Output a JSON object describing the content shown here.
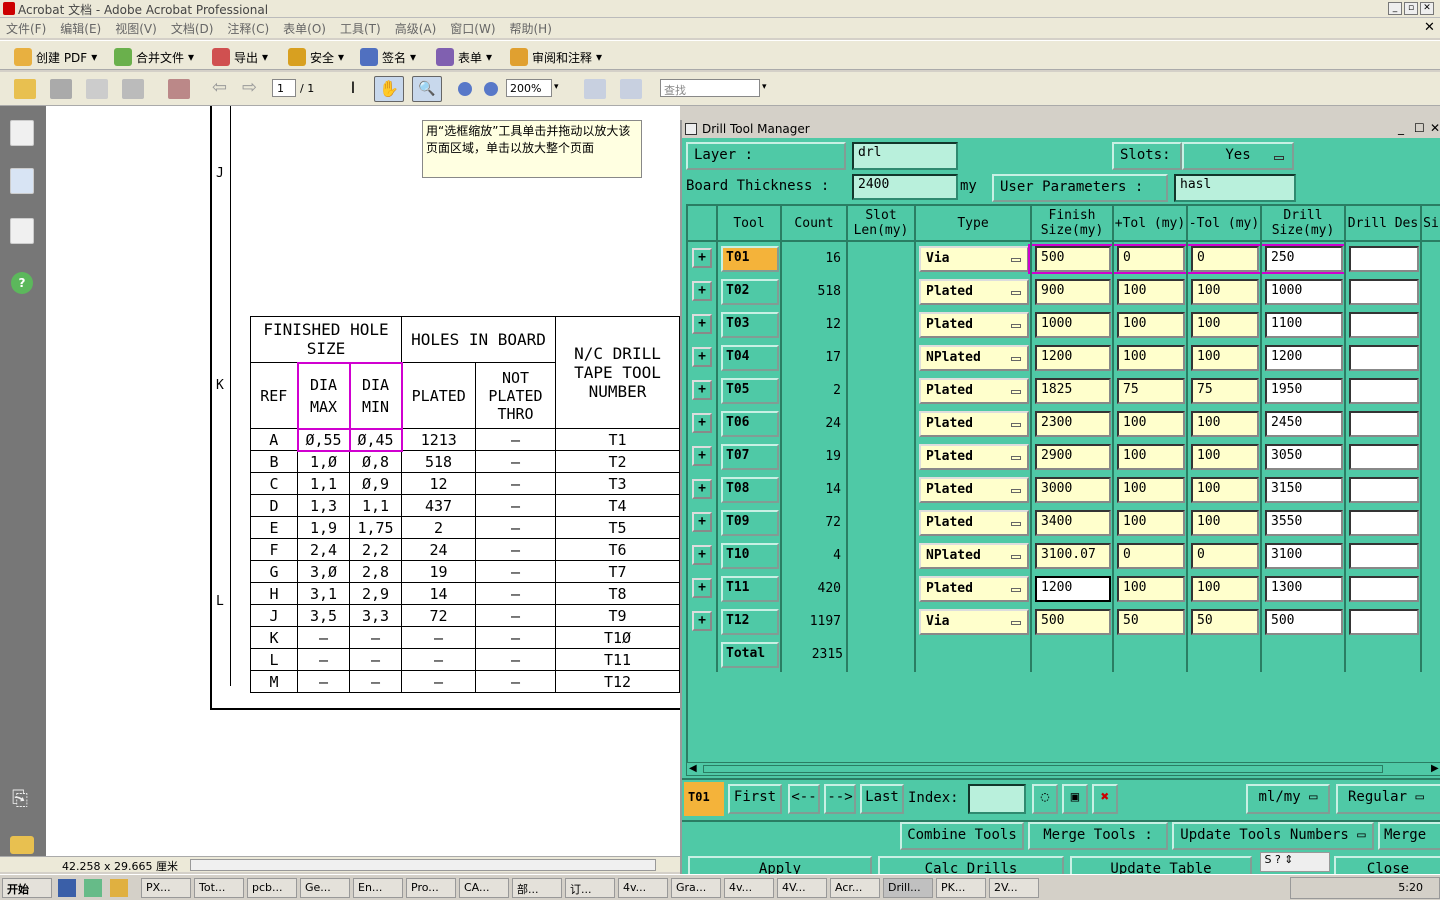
{
  "window": {
    "title": "Acrobat 文档 - Adobe Acrobat Professional"
  },
  "menu": [
    "文件(F)",
    "编辑(E)",
    "视图(V)",
    "文档(D)",
    "注释(C)",
    "表单(O)",
    "工具(T)",
    "高级(A)",
    "窗口(W)",
    "帮助(H)"
  ],
  "toolbar1": [
    "创建 PDF",
    "合并文件",
    "导出",
    "安全",
    "签名",
    "表单",
    "审阅和注释"
  ],
  "toolbar2": {
    "page_current": "1",
    "page_total": "/ 1",
    "zoom": "200%",
    "search_placeholder": "查找"
  },
  "tooltip": "用“选框缩放”工具单击并拖动以放大该页面区域，单击以放大整个页面",
  "status": {
    "page_size": "42.258 x 29.665 厘米"
  },
  "drawing": {
    "row_letters": {
      "j": "J",
      "k": "K",
      "l": "L"
    },
    "table_headers": {
      "finished": "FINISHED HOLE SIZE",
      "holes": "HOLES IN BOARD",
      "nc": "N/C DRILL TAPE TOOL NUMBER",
      "ref": "REF",
      "dia_max": "DIA MAX",
      "dia_min": "DIA MIN",
      "plated": "PLATED",
      "not_plated": "NOT PLATED THRO"
    },
    "rows": [
      [
        "A",
        "Ø,55",
        "Ø,45",
        "1213",
        "–",
        "T1"
      ],
      [
        "B",
        "1,Ø",
        "Ø,8",
        "518",
        "–",
        "T2"
      ],
      [
        "C",
        "1,1",
        "Ø,9",
        "12",
        "–",
        "T3"
      ],
      [
        "D",
        "1,3",
        "1,1",
        "437",
        "–",
        "T4"
      ],
      [
        "E",
        "1,9",
        "1,75",
        "2",
        "–",
        "T5"
      ],
      [
        "F",
        "2,4",
        "2,2",
        "24",
        "–",
        "T6"
      ],
      [
        "G",
        "3,Ø",
        "2,8",
        "19",
        "–",
        "T7"
      ],
      [
        "H",
        "3,1",
        "2,9",
        "14",
        "–",
        "T8"
      ],
      [
        "J",
        "3,5",
        "3,3",
        "72",
        "–",
        "T9"
      ],
      [
        "K",
        "–",
        "–",
        "–",
        "–",
        "T1Ø"
      ],
      [
        "L",
        "–",
        "–",
        "–",
        "–",
        "T11"
      ],
      [
        "M",
        "–",
        "–",
        "–",
        "–",
        "T12"
      ]
    ]
  },
  "dtm": {
    "title": "Drill Tool Manager",
    "layer_label": "Layer           :",
    "layer_value": "drl",
    "slots_label": "Slots:",
    "slots_value": "Yes",
    "board_thickness_label": "Board Thickness :",
    "board_thickness_value": "2400",
    "board_unit": "my",
    "user_params_label": "User Parameters :",
    "user_params_value": "hasl",
    "columns": [
      "Tool",
      "Count",
      "Slot Len(my)",
      "Type",
      "Finish Size(my)",
      "+Tol (my)",
      "-Tol (my)",
      "Drill Size(my)",
      "Drill Des",
      "Si"
    ],
    "tools": [
      {
        "tool": "T01",
        "count": "16",
        "type": "Via",
        "finish": "500",
        "ptol": "0",
        "mtol": "0",
        "drill": "250"
      },
      {
        "tool": "T02",
        "count": "518",
        "type": "Plated",
        "finish": "900",
        "ptol": "100",
        "mtol": "100",
        "drill": "1000"
      },
      {
        "tool": "T03",
        "count": "12",
        "type": "Plated",
        "finish": "1000",
        "ptol": "100",
        "mtol": "100",
        "drill": "1100"
      },
      {
        "tool": "T04",
        "count": "17",
        "type": "NPlated",
        "finish": "1200",
        "ptol": "100",
        "mtol": "100",
        "drill": "1200"
      },
      {
        "tool": "T05",
        "count": "2",
        "type": "Plated",
        "finish": "1825",
        "ptol": "75",
        "mtol": "75",
        "drill": "1950"
      },
      {
        "tool": "T06",
        "count": "24",
        "type": "Plated",
        "finish": "2300",
        "ptol": "100",
        "mtol": "100",
        "drill": "2450"
      },
      {
        "tool": "T07",
        "count": "19",
        "type": "Plated",
        "finish": "2900",
        "ptol": "100",
        "mtol": "100",
        "drill": "3050"
      },
      {
        "tool": "T08",
        "count": "14",
        "type": "Plated",
        "finish": "3000",
        "ptol": "100",
        "mtol": "100",
        "drill": "3150"
      },
      {
        "tool": "T09",
        "count": "72",
        "type": "Plated",
        "finish": "3400",
        "ptol": "100",
        "mtol": "100",
        "drill": "3550"
      },
      {
        "tool": "T10",
        "count": "4",
        "type": "NPlated",
        "finish": "3100.07",
        "ptol": "0",
        "mtol": "0",
        "drill": "3100"
      },
      {
        "tool": "T11",
        "count": "420",
        "type": "Plated",
        "finish": "1200",
        "ptol": "100",
        "mtol": "100",
        "drill": "1300"
      },
      {
        "tool": "T12",
        "count": "1197",
        "type": "Via",
        "finish": "500",
        "ptol": "50",
        "mtol": "50",
        "drill": "500"
      }
    ],
    "total_label": "Total",
    "total_count": "2315",
    "nav": {
      "current": "T01",
      "first": "First",
      "prev": "<--",
      "next": "-->",
      "last": "Last",
      "index_label": "Index:",
      "unit": "ml/my",
      "mode": "Regular"
    },
    "actions": {
      "combine": "Combine Tools",
      "merge": "Merge Tools  :",
      "update_numbers": "Update Tools Numbers",
      "merge2": "Merge",
      "apply": "Apply",
      "calc": "Calc Drills",
      "update_table": "Update Table",
      "close": "Close"
    }
  },
  "taskbar": {
    "start": "开始",
    "clock": "5:20",
    "tasks": [
      "PX...",
      "Tot...",
      "pcb...",
      "Ge...",
      "En...",
      "Pro...",
      "CA...",
      "部...",
      "订...",
      "4v...",
      "Gra...",
      "4v...",
      "4V...",
      "Acr...",
      "Drill...",
      "PK...",
      "2V..."
    ]
  }
}
